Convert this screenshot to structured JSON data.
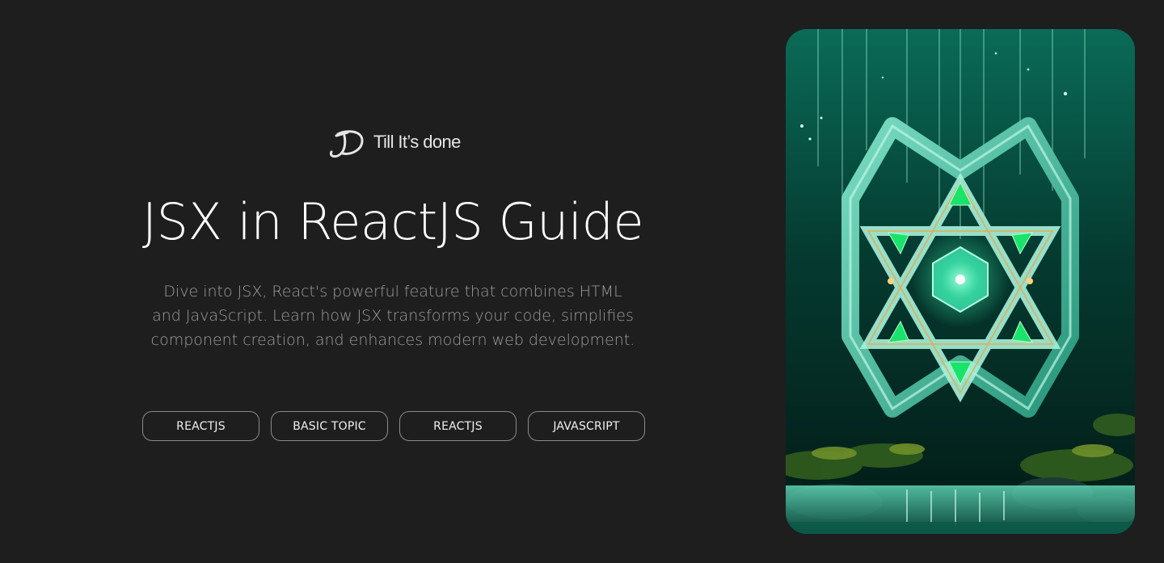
{
  "brand": {
    "name": "Till It’s done",
    "logo_icon": "td-monogram-icon"
  },
  "hero": {
    "title": "JSX in ReactJS Guide",
    "description_lines": [
      "Dive into JSX, React's powerful feature that combines HTML",
      "and JavaScript. Learn how JSX transforms your code, simplifies",
      "component creation, and enhances modern web development."
    ]
  },
  "tags": [
    {
      "label": "REACTJS"
    },
    {
      "label": "BASIC TOPIC"
    },
    {
      "label": "REACTJS"
    },
    {
      "label": "JAVASCRIPT"
    }
  ],
  "image": {
    "subject": "emerald-react-logo-artwork",
    "colors": {
      "primary": "#12c49a",
      "glow": "#3dffb0",
      "dark": "#03251e"
    }
  }
}
